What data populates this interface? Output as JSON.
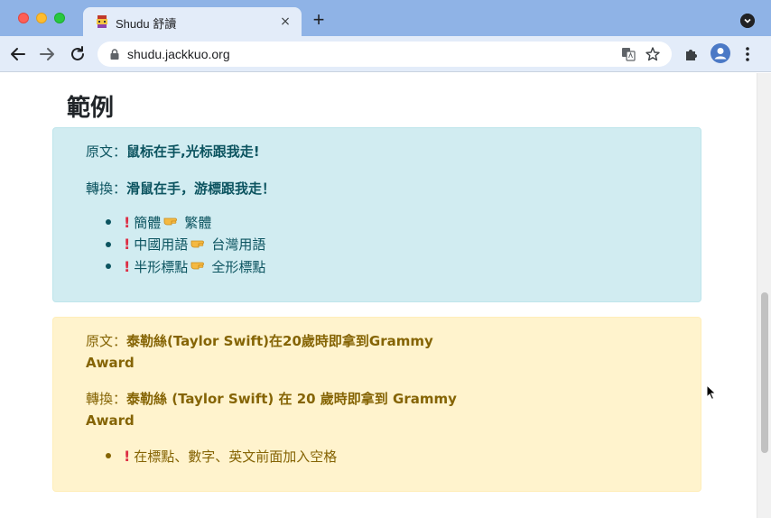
{
  "browser": {
    "tab_title": "Shudu 舒讀",
    "tab_close": "×",
    "new_tab": "+",
    "url": "shudu.jackkuo.org"
  },
  "page": {
    "heading": "範例",
    "example1": {
      "original_label": "原文：",
      "original_text": "鼠标在手,光标跟我走!",
      "converted_label": "轉換：",
      "converted_text": "滑鼠在手，游標跟我走！",
      "bullets": [
        {
          "from": "簡體",
          "to": "繁體"
        },
        {
          "from": "中國用語",
          "to": "台灣用語"
        },
        {
          "from": "半形標點",
          "to": "全形標點"
        }
      ]
    },
    "example2": {
      "original_label": "原文：",
      "original_text": "泰勒絲(Taylor Swift)在20歲時即拿到Grammy Award",
      "converted_label": "轉換：",
      "converted_text": "泰勒絲 (Taylor Swift) 在 20 歲時即拿到 Grammy Award",
      "bullets": [
        {
          "text": "在標點、數字、英文前面加入空格"
        }
      ]
    }
  },
  "colors": {
    "info_bg": "#d1ecf1",
    "info_text": "#0c5460",
    "warning_bg": "#fff3cd",
    "warning_text": "#856404",
    "exclamation": "#dd2e44",
    "tabstrip": "#8fb3e6",
    "toolbar": "#e3ecf9"
  }
}
